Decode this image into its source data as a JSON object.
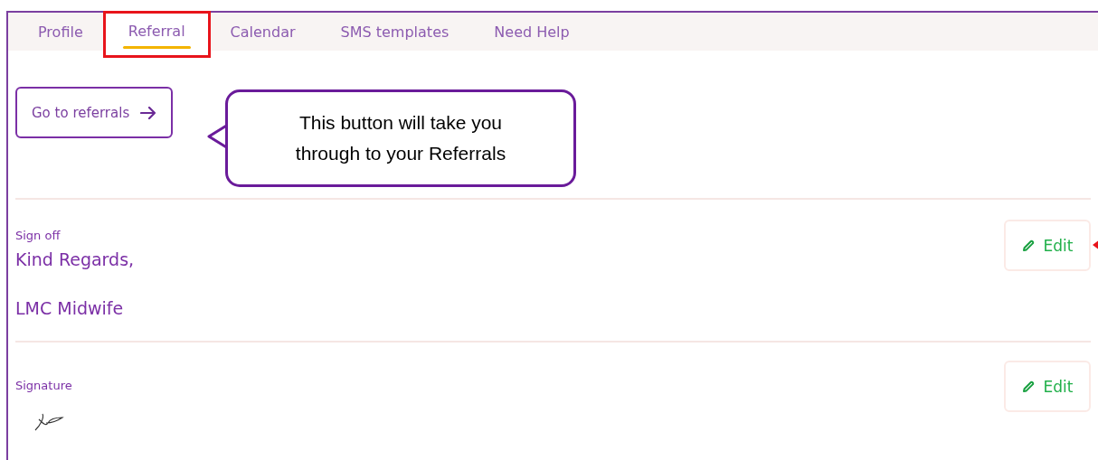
{
  "tabs": [
    {
      "label": "Profile",
      "selected": false,
      "highlighted": false
    },
    {
      "label": "Referral",
      "selected": true,
      "highlighted": true
    },
    {
      "label": "Calendar",
      "selected": false,
      "highlighted": false
    },
    {
      "label": "SMS templates",
      "selected": false,
      "highlighted": false
    },
    {
      "label": "Need Help",
      "selected": false,
      "highlighted": false
    }
  ],
  "go_button": {
    "label": "Go to referrals"
  },
  "callout": {
    "text": "This button will take you through to your Referrals"
  },
  "sections": [
    {
      "kind": "text",
      "label": "Sign off",
      "lines": [
        "Kind Regards,",
        "LMC Midwife"
      ],
      "edit": "Edit",
      "pointer": true
    },
    {
      "kind": "signature",
      "label": "Signature",
      "edit": "Edit",
      "pointer": false
    }
  ]
}
